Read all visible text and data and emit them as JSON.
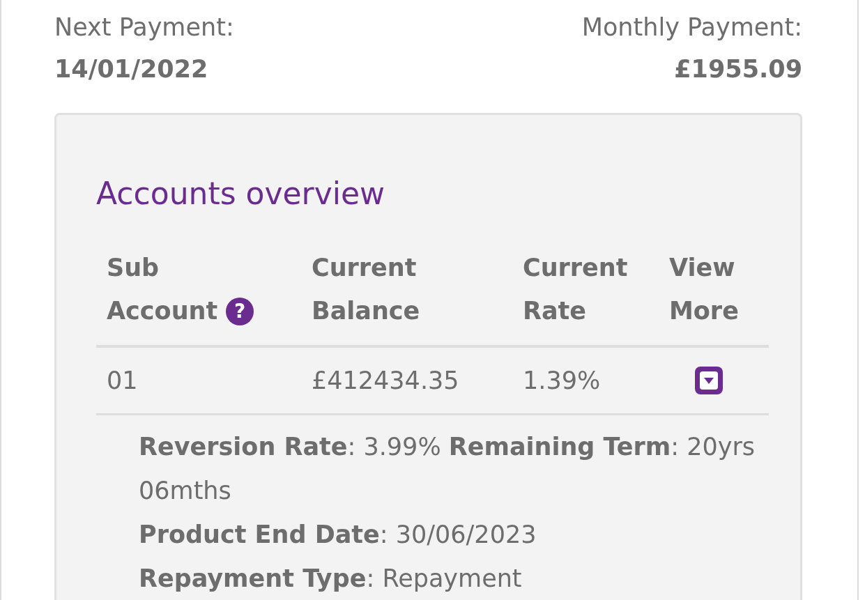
{
  "summary": [
    {
      "label": "Next Payment:",
      "value": "14/01/2022"
    },
    {
      "label": "Monthly Payment:",
      "value": "£1955.09"
    }
  ],
  "accounts": {
    "title": "Accounts overview",
    "columns": [
      {
        "lines": [
          "Sub",
          "Account"
        ],
        "help_icon": "?"
      },
      {
        "lines": [
          "Current",
          "Balance"
        ]
      },
      {
        "lines": [
          "Current",
          "Rate"
        ]
      },
      {
        "lines": [
          "View",
          "More"
        ]
      }
    ],
    "rows": [
      {
        "sub_account": "01",
        "balance": "£412434.35",
        "rate": "1.39%",
        "expanded": true,
        "details": [
          "**Reversion Rate**: 3.99% **Remaining Term**: 20yrs 06mths",
          "**Product End Date**: 30/06/2023",
          "**Repayment Type**: Repayment"
        ]
      }
    ]
  }
}
